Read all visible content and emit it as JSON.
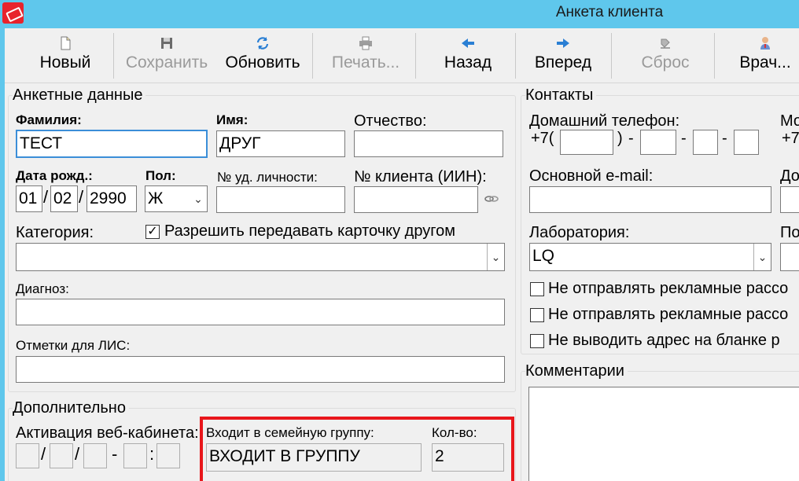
{
  "window": {
    "title": "Анкета клиента"
  },
  "toolbar": {
    "new": "Новый",
    "save": "Сохранить",
    "refresh": "Обновить",
    "print": "Печать...",
    "back": "Назад",
    "forward": "Вперед",
    "reset": "Сброс",
    "doctor": "Врач..."
  },
  "personal": {
    "section_title": "Анкетные данные",
    "surname_label": "Фамилия:",
    "surname_value": "ТЕСТ",
    "name_label": "Имя:",
    "name_value": "ДРУГ",
    "patronymic_label": "Отчество:",
    "patronymic_value": "",
    "birth_label": "Дата рожд.:",
    "birth_day": "01",
    "birth_month": "02",
    "birth_year": "2990",
    "birth_sep": "/",
    "gender_label": "Пол:",
    "gender_value": "Ж",
    "id_doc_label": "№ уд. личности:",
    "client_no_label": "№ клиента (ИИН):",
    "category_label": "Категория:",
    "allow_transfer_label": "Разрешить передавать карточку другом",
    "diagnosis_label": "Диагноз:",
    "lis_notes_label": "Отметки для ЛИС:"
  },
  "contacts": {
    "section_title": "Контакты",
    "home_phone_label": "Домашний телефон:",
    "phone_prefix": "+7(",
    "phone_close": ")",
    "phone_dash": "-",
    "mobile_label_partial": "Мо",
    "mobile_prefix_partial": "+7",
    "email_label": "Основной e-mail:",
    "extra_label_partial": "До",
    "lab_label": "Лаборатория:",
    "lab_value": "LQ",
    "extra2_label_partial": "По",
    "opt1_label": "Не отправлять рекламные рассо",
    "opt2_label": "Не отправлять рекламные рассо",
    "opt3_label": "Не выводить адрес на бланке р"
  },
  "comments": {
    "section_title": "Комментарии"
  },
  "additional": {
    "section_title": "Дополнительно",
    "web_cabinet_label": "Активация веб-кабинета:",
    "family_group_label": "Входит в семейную группу:",
    "family_group_value": "ВХОДИТ В ГРУППУ",
    "count_label": "Кол-во:",
    "count_value": "2",
    "sep_slash": "/",
    "sep_dash": "-",
    "sep_colon": ":"
  }
}
